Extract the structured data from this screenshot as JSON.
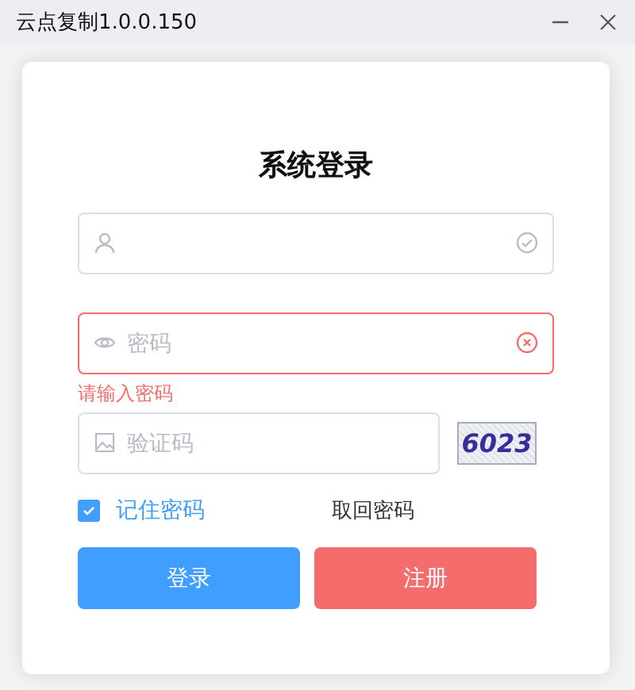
{
  "window": {
    "title": "云点复制1.0.0.150"
  },
  "login": {
    "title": "系统登录",
    "fields": [
      {
        "kind": "user",
        "invalid": false
      },
      {
        "kind": "password",
        "placeholder": "密码",
        "invalid": true,
        "error": "请输入密码"
      }
    ],
    "captcha": {
      "placeholder": "验证码",
      "code": "6023"
    },
    "remember": {
      "label": "记住密码",
      "checked": true
    },
    "recover_link": "取回密码",
    "buttons": [
      {
        "label": "登录",
        "kind": "primary"
      },
      {
        "label": "注册",
        "kind": "danger"
      }
    ]
  }
}
